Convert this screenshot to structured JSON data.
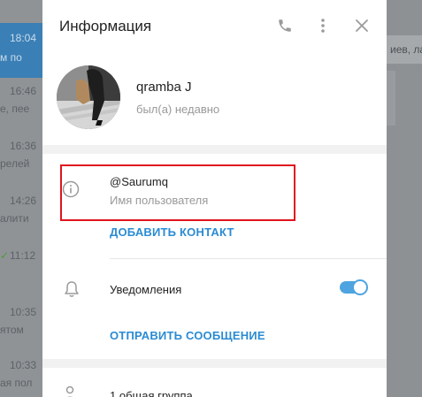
{
  "background": {
    "chat_items": [
      {
        "time": "18:04",
        "snippet": "м по"
      },
      {
        "time": "16:46",
        "snippet": "е, пее"
      },
      {
        "time": "16:36",
        "snippet": "релей"
      },
      {
        "time": "14:26",
        "snippet": "алити"
      },
      {
        "time": "11:12",
        "snippet": ""
      },
      {
        "time": "10:35",
        "snippet": "ятом"
      },
      {
        "time": "10:33",
        "snippet": "ая пол"
      }
    ],
    "right_snippet": "иев, ла"
  },
  "dialog": {
    "title": "Информация",
    "header_icons": [
      "phone-icon",
      "more-vertical-icon",
      "close-icon"
    ]
  },
  "profile": {
    "name": "qramba J",
    "status": "был(а) недавно"
  },
  "info": {
    "username": "@Saurumq",
    "username_label": "Имя пользователя",
    "add_contact": "ДОБАВИТЬ КОНТАКТ"
  },
  "notifications": {
    "label": "Уведомления",
    "enabled": true,
    "send_message": "ОТПРАВИТЬ СООБЩЕНИЕ"
  },
  "groups": {
    "label": "1 общая группа"
  },
  "colors": {
    "accent": "#2a8bd3",
    "toggle": "#4ea4e0",
    "highlight_box": "#e0141e"
  }
}
